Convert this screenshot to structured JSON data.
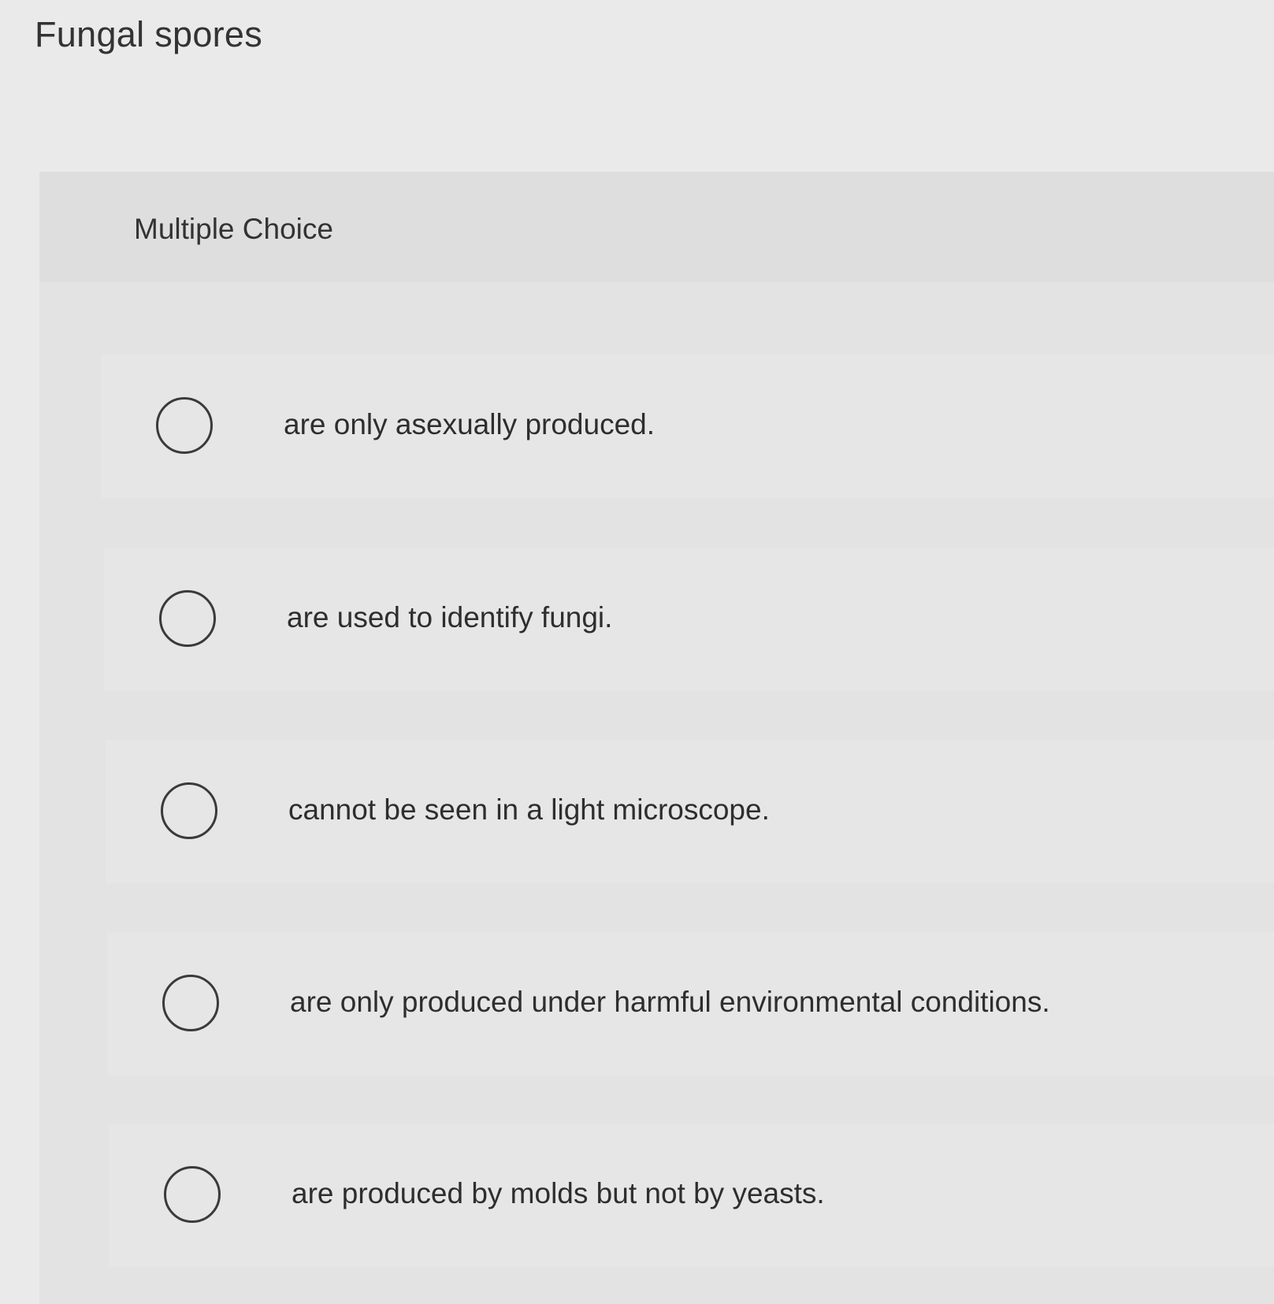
{
  "question": {
    "stem": "Fungal spores",
    "type_label": "Multiple Choice"
  },
  "choices": [
    {
      "label": "are only asexually produced."
    },
    {
      "label": "are used to identify fungi."
    },
    {
      "label": "cannot be seen in a light microscope."
    },
    {
      "label": "are only produced under harmful environmental conditions."
    },
    {
      "label": "are produced by molds but not by yeasts."
    }
  ]
}
